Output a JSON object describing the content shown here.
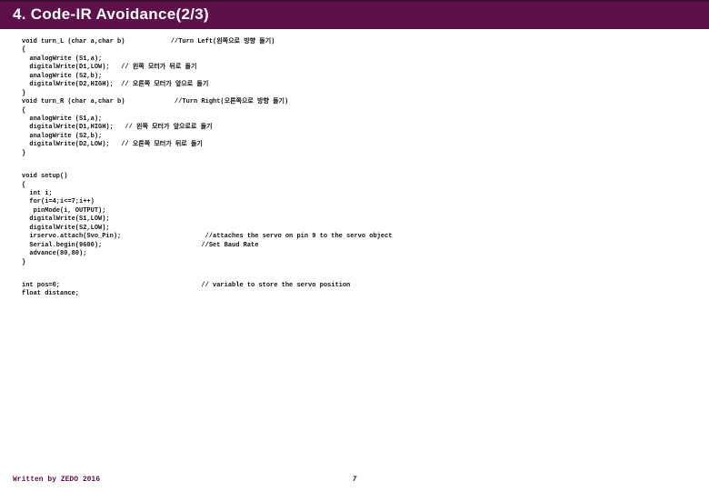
{
  "header": {
    "title": "4. Code-IR Avoidance(2/3)"
  },
  "code": {
    "block1": "void turn_L (char a,char b)            //Turn Left(왼쪽으로 방향 돌기)\n{\n  analogWrite (S1,a);\n  digitalWrite(D1,LOW);   // 왼쪽 모터가 뒤로 돌기\n  analogWrite (S2,b);\n  digitalWrite(D2,HIGH);  // 오른쪽 모터가 앞으로 돌기\n}\nvoid turn_R (char a,char b)             //Turn Right(오른쪽으로 방향 돌기)\n{\n  analogWrite (S1,a);\n  digitalWrite(D1,HIGH);   // 왼쪽 모터가 앞으로로 돌기\n  analogWrite (S2,b);\n  digitalWrite(D2,LOW);   // 오른쪽 모터가 뒤로 돌기\n}",
    "block2": "void setup()\n{\n  int i;\n  for(i=4;i<=7;i++)\n   pinMode(i, OUTPUT);\n  digitalWrite(S1,LOW);\n  digitalWrite(S2,LOW);\n  irservo.attach(Svo_Pin);                      //attaches the servo on pin 9 to the servo object\n  Serial.begin(9600);                          //Set Baud Rate\n  advance(80,80);\n}",
    "block3": "int pos=0;                                     // variable to store the servo position\nfloat distance;"
  },
  "footer": {
    "credit": "Written by ZEDO 2016",
    "page": "7"
  }
}
